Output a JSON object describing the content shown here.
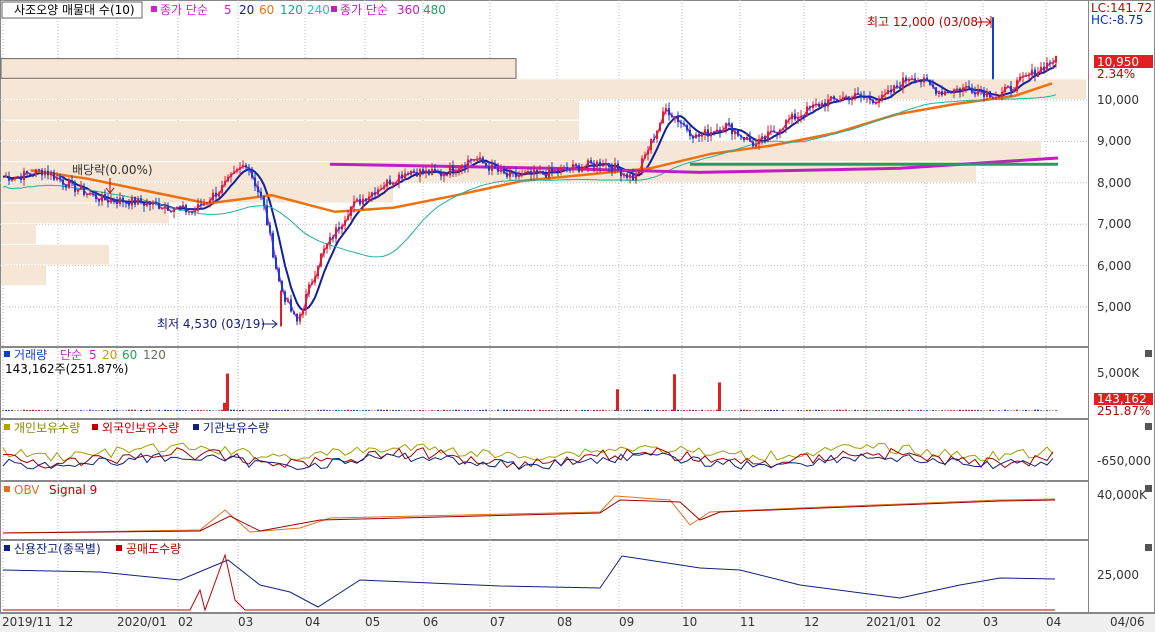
{
  "colors": {
    "up": "#e02020",
    "down": "#1040d0",
    "ma5": "#d020d0",
    "ma20": "#1020a0",
    "ma60": "#f07010",
    "ma120": "#20b0a0",
    "ma240": "#20c0c0",
    "ma360": "#c020c0",
    "ma480": "#20a060",
    "profile": "#f5e6d6",
    "profile_border": "#c8a888",
    "grid": "#bbbbbb",
    "frame": "#888888",
    "lc_label": "#c00000",
    "hc_label": "#0030c0",
    "price_box": "#e02020"
  },
  "main": {
    "title": "사조오양 매물대 수(10)",
    "ma_label": "종가 단순",
    "ma_periods_a": [
      "5",
      "20",
      "60",
      "120",
      "240"
    ],
    "ma_label2": "종가 단순",
    "ma_periods_b": [
      "360",
      "480"
    ],
    "lc": "LC:141.72",
    "hc": "HC:-8.75",
    "last_price": "10,950",
    "last_change": "2.34%",
    "high_label": "최고 12,000 (03/08)",
    "low_label": "최저 4,530 (03/19)",
    "dividend_label": "배당락(0.00%)",
    "y_ticks": [
      "10,000",
      "9,000",
      "8,000",
      "7,000",
      "6,000",
      "5,000"
    ]
  },
  "volume": {
    "title": "거래량",
    "ma_label": "단순",
    "periods": [
      "5",
      "20",
      "60",
      "120"
    ],
    "current": "143,162주(251.87%)",
    "tick": "5,000K",
    "last_value": "143,162",
    "last_pct": "251.87%"
  },
  "holders": {
    "series": [
      "개인보유수량",
      "외국인보유수량",
      "기관보유수량"
    ],
    "tick": "-650,000"
  },
  "obv": {
    "series": [
      "OBV",
      "Signal 9"
    ],
    "tick": "40,000K"
  },
  "credit": {
    "series": [
      "신용잔고(종목별)",
      "공매도수량"
    ],
    "tick": "25,000"
  },
  "x_axis": [
    "2019/11",
    "12",
    "2020/01",
    "02",
    "03",
    "04",
    "05",
    "06",
    "07",
    "08",
    "09",
    "10",
    "11",
    "12",
    "2021/01",
    "02",
    "03",
    "04",
    "04/06"
  ],
  "chart_data": {
    "type": "candlestick",
    "title": "사조오양 매물대 수(10)",
    "x_range": [
      "2019/11",
      "2021/04"
    ],
    "ylim": [
      4300,
      12300
    ],
    "y_ticks": [
      5000,
      6000,
      7000,
      8000,
      9000,
      10000
    ],
    "last_close": 10950,
    "last_change_pct": 2.34,
    "high": {
      "value": 12000,
      "date": "03/08"
    },
    "low": {
      "value": 4530,
      "date": "03/19"
    },
    "close_path": [
      [
        "2019/11",
        8150
      ],
      [
        "2019/11",
        8300
      ],
      [
        "2019/12",
        7900
      ],
      [
        "2019/12",
        7600
      ],
      [
        "2020/01",
        7550
      ],
      [
        "2020/01",
        7450
      ],
      [
        "2020/02",
        7300
      ],
      [
        "2020/02",
        7900
      ],
      [
        "2020/03",
        8500
      ],
      [
        "2020/03",
        7500
      ],
      [
        "2020/03",
        5500
      ],
      [
        "2020/03",
        4600
      ],
      [
        "2020/04",
        6200
      ],
      [
        "2020/04",
        7400
      ],
      [
        "2020/05",
        7900
      ],
      [
        "2020/05",
        8300
      ],
      [
        "2020/06",
        8200
      ],
      [
        "2020/06",
        8600
      ],
      [
        "2020/07",
        8150
      ],
      [
        "2020/07",
        8200
      ],
      [
        "2020/08",
        8350
      ],
      [
        "2020/08",
        8500
      ],
      [
        "2020/09",
        8100
      ],
      [
        "2020/09",
        9800
      ],
      [
        "2020/10",
        9100
      ],
      [
        "2020/10",
        9400
      ],
      [
        "2020/11",
        8900
      ],
      [
        "2020/11",
        9500
      ],
      [
        "2020/12",
        9900
      ],
      [
        "2020/12",
        10100
      ],
      [
        "2021/01",
        10000
      ],
      [
        "2021/01",
        10600
      ],
      [
        "2021/02",
        10200
      ],
      [
        "2021/02",
        10300
      ],
      [
        "2021/03",
        10100
      ],
      [
        "2021/03",
        10600
      ],
      [
        "2021/04",
        10950
      ]
    ],
    "ma60_path": [
      [
        "2019/11",
        8300
      ],
      [
        "2019/12",
        8100
      ],
      [
        "2020/01",
        7800
      ],
      [
        "2020/02",
        7500
      ],
      [
        "2020/03",
        7700
      ],
      [
        "2020/04",
        7300
      ],
      [
        "2020/05",
        7400
      ],
      [
        "2020/06",
        7700
      ],
      [
        "2020/07",
        8050
      ],
      [
        "2020/08",
        8200
      ],
      [
        "2020/09",
        8350
      ],
      [
        "2020/10",
        8700
      ],
      [
        "2020/11",
        8900
      ],
      [
        "2020/12",
        9200
      ],
      [
        "2021/01",
        9650
      ],
      [
        "2021/02",
        9900
      ],
      [
        "2021/03",
        10100
      ],
      [
        "2021/04",
        10400
      ]
    ],
    "volume_spikes": [
      [
        "2020/03",
        1200
      ],
      [
        "2020/03",
        5500
      ],
      [
        "2020/09",
        3200
      ],
      [
        "2020/10",
        5400
      ],
      [
        "2020/10",
        4200
      ]
    ]
  }
}
